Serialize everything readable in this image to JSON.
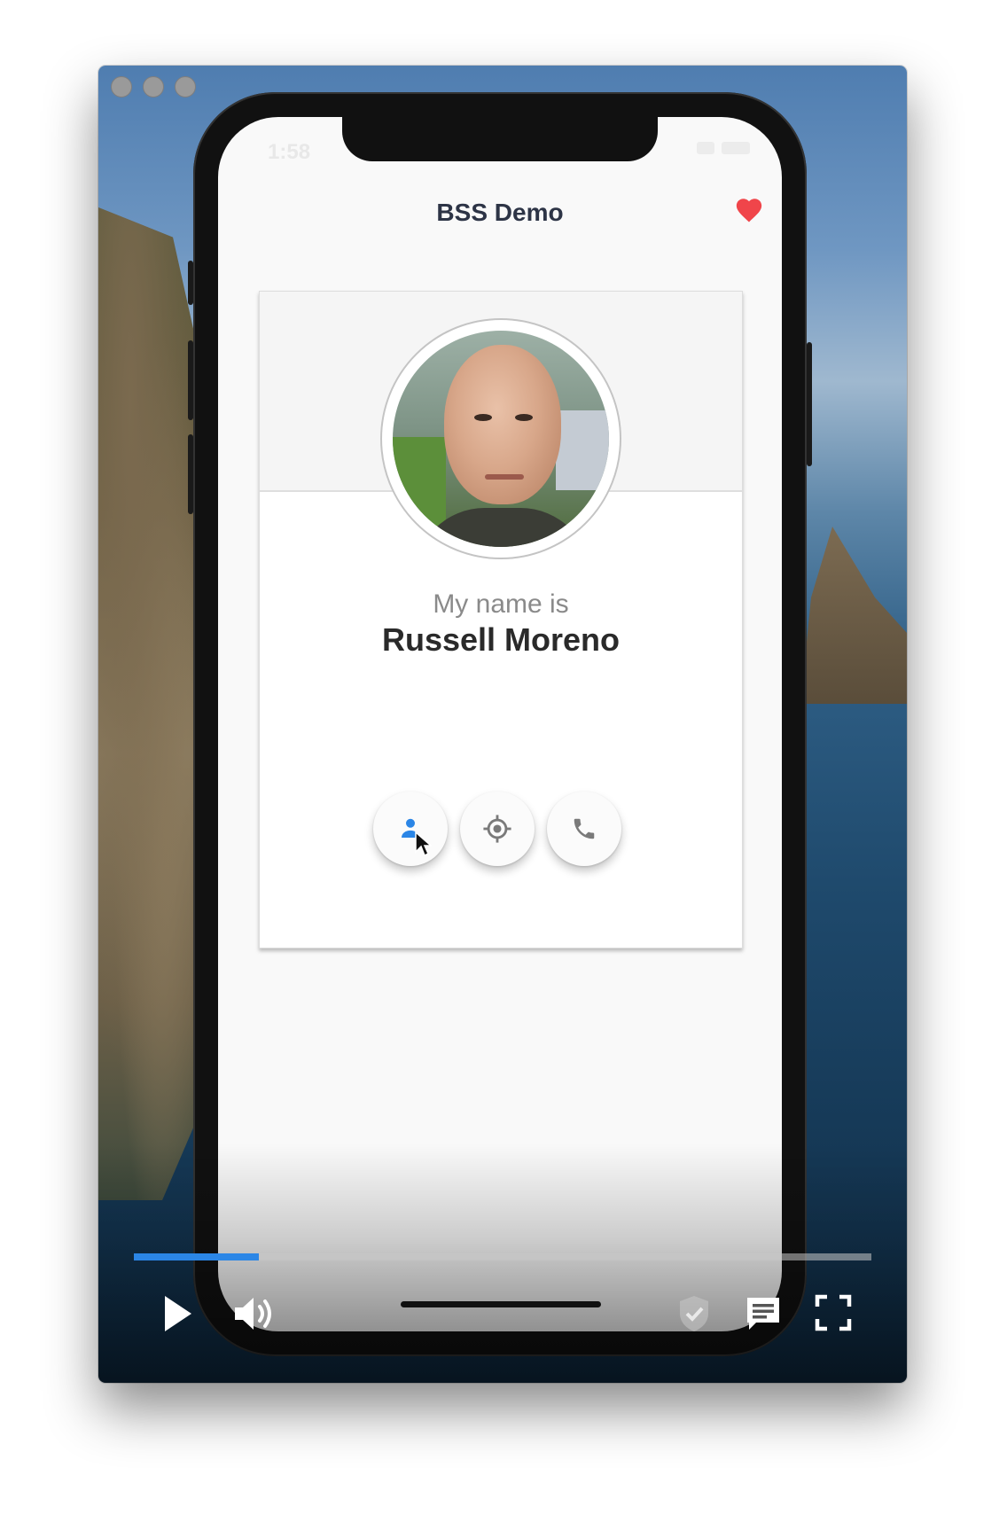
{
  "window": {
    "name": "video-player-window"
  },
  "app": {
    "title": "BSS Demo",
    "status_time": "1:58"
  },
  "card": {
    "subtitle": "My name is",
    "name": "Russell Moreno",
    "actions": [
      {
        "icon": "person-icon",
        "active": true
      },
      {
        "icon": "location-icon",
        "active": false
      },
      {
        "icon": "phone-icon",
        "active": false
      }
    ]
  },
  "player": {
    "progress": 0.17,
    "accent_color": "#2b86e6"
  },
  "colors": {
    "heart": "#f0454a",
    "title": "#2d3446",
    "active_icon": "#2b86e6",
    "inactive_icon": "#7a7a7a"
  }
}
